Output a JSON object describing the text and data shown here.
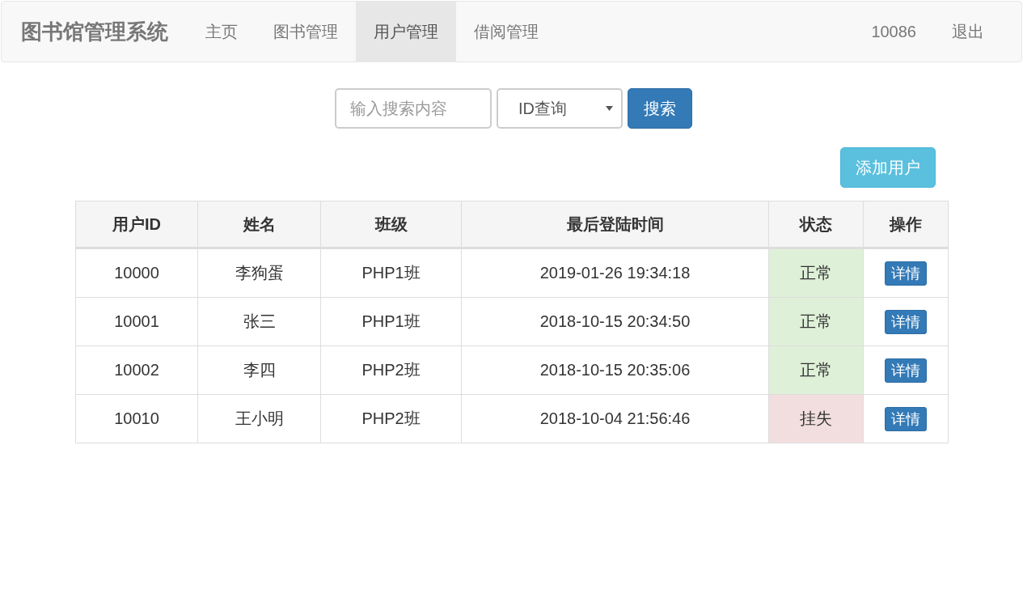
{
  "navbar": {
    "brand": "图书馆管理系统",
    "items": [
      {
        "label": "主页",
        "selected": false
      },
      {
        "label": "图书管理",
        "selected": false
      },
      {
        "label": "用户管理",
        "selected": true
      },
      {
        "label": "借阅管理",
        "selected": false
      }
    ],
    "right_items": [
      "10086",
      "退出"
    ]
  },
  "search": {
    "placeholder": "输入搜索内容",
    "select_value": "ID查询",
    "button": "搜索"
  },
  "add_button": "添加用户",
  "table": {
    "columns": [
      "用户ID",
      "姓名",
      "班级",
      "最后登陆时间",
      "状态",
      "操作"
    ],
    "rows": [
      {
        "id": "10000",
        "name": "李狗蛋",
        "class": "PHP1班",
        "last_login": "2019-01-26 19:34:18",
        "status": "正常",
        "color": "#dff0d8",
        "action": "详情"
      },
      {
        "id": "10001",
        "name": "张三",
        "class": "PHP1班",
        "last_login": "2018-10-15 20:34:50",
        "status": "正常",
        "color": "#dff0d8",
        "action": "详情"
      },
      {
        "id": "10002",
        "name": "李四",
        "class": "PHP2班",
        "last_login": "2018-10-15 20:35:06",
        "status": "正常",
        "color": "#dff0d8",
        "action": "详情"
      },
      {
        "id": "10010",
        "name": "王小明",
        "class": "PHP2班",
        "last_login": "2018-10-04 21:56:46",
        "status": "挂失",
        "color": "#f2dede",
        "action": "详情"
      }
    ]
  }
}
